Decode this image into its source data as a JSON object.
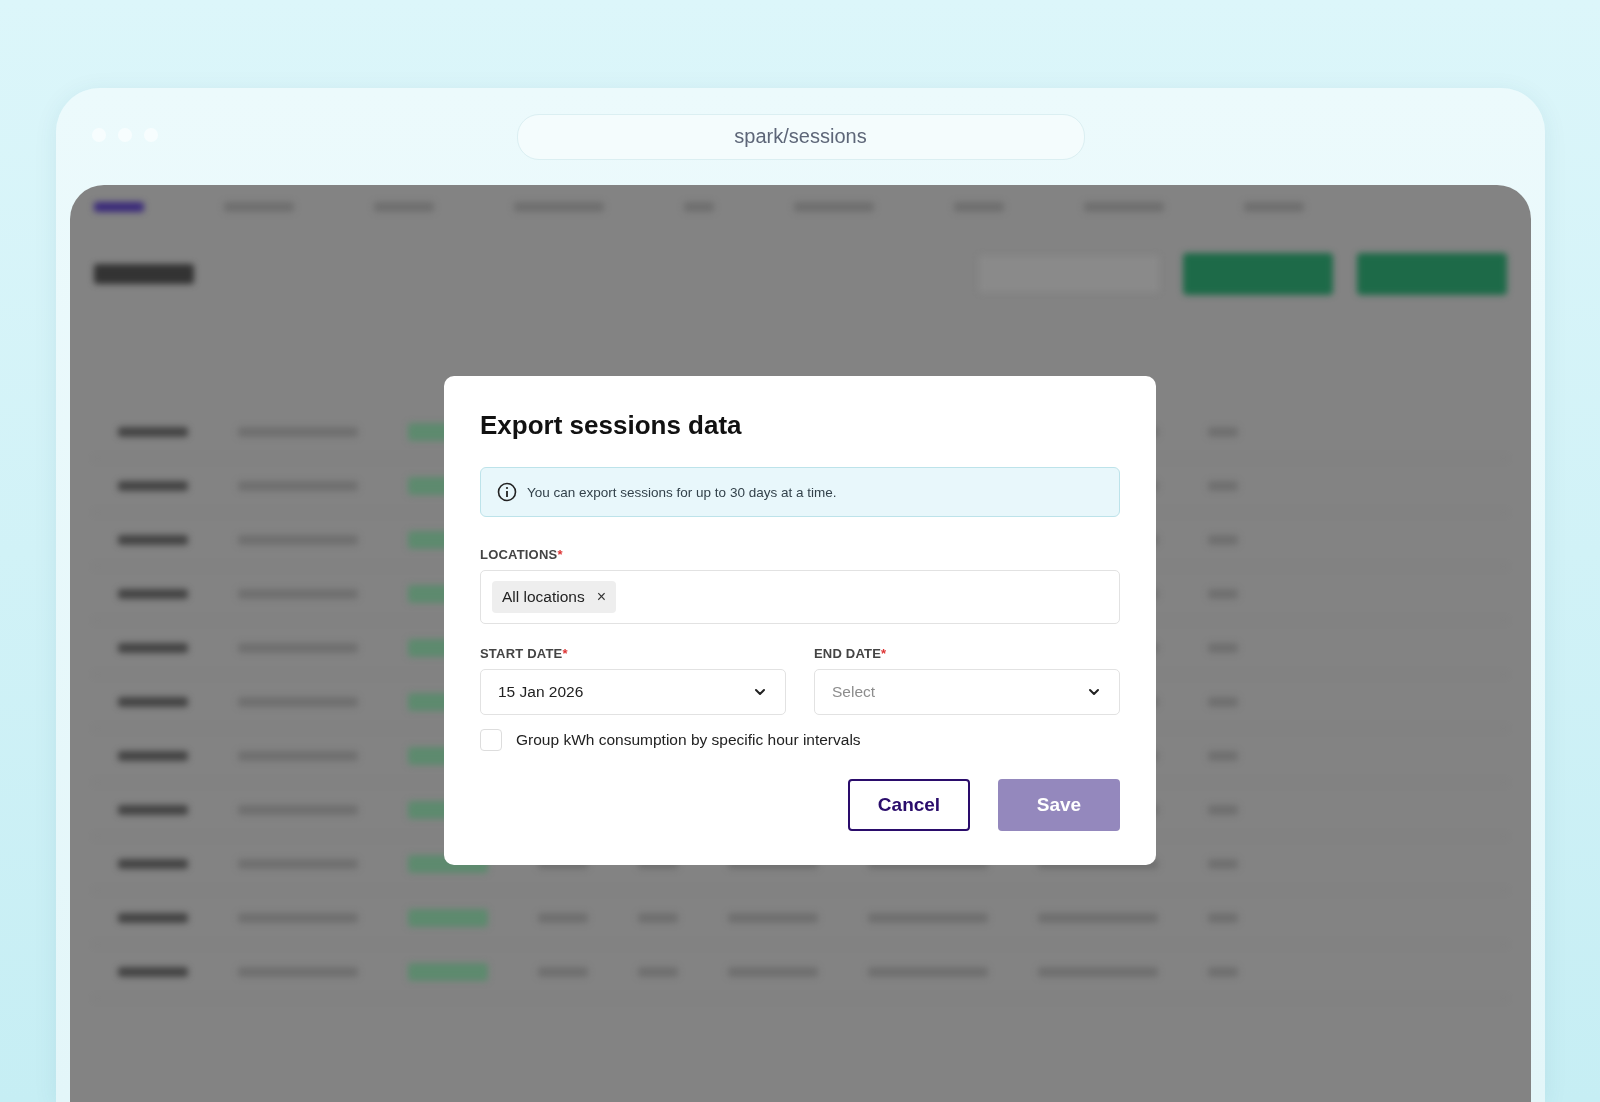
{
  "browser": {
    "url": "spark/sessions"
  },
  "dialog": {
    "title": "Export sessions data",
    "notice": "You can export sessions for up to 30 days at a time.",
    "locations": {
      "label": "LOCATIONS",
      "required_mark": "*",
      "chips": [
        {
          "label": "All locations",
          "remove": "×"
        }
      ]
    },
    "start_date": {
      "label": "START DATE",
      "required_mark": "*",
      "value": "15 Jan 2026"
    },
    "end_date": {
      "label": "END DATE",
      "required_mark": "*",
      "placeholder": "Select"
    },
    "group_option": {
      "label": "Group kWh consumption by specific hour intervals",
      "checked": false
    },
    "buttons": [
      {
        "label": "Cancel",
        "kind": "secondary",
        "disabled": false
      },
      {
        "label": "Save",
        "kind": "primary",
        "disabled": true
      }
    ]
  }
}
